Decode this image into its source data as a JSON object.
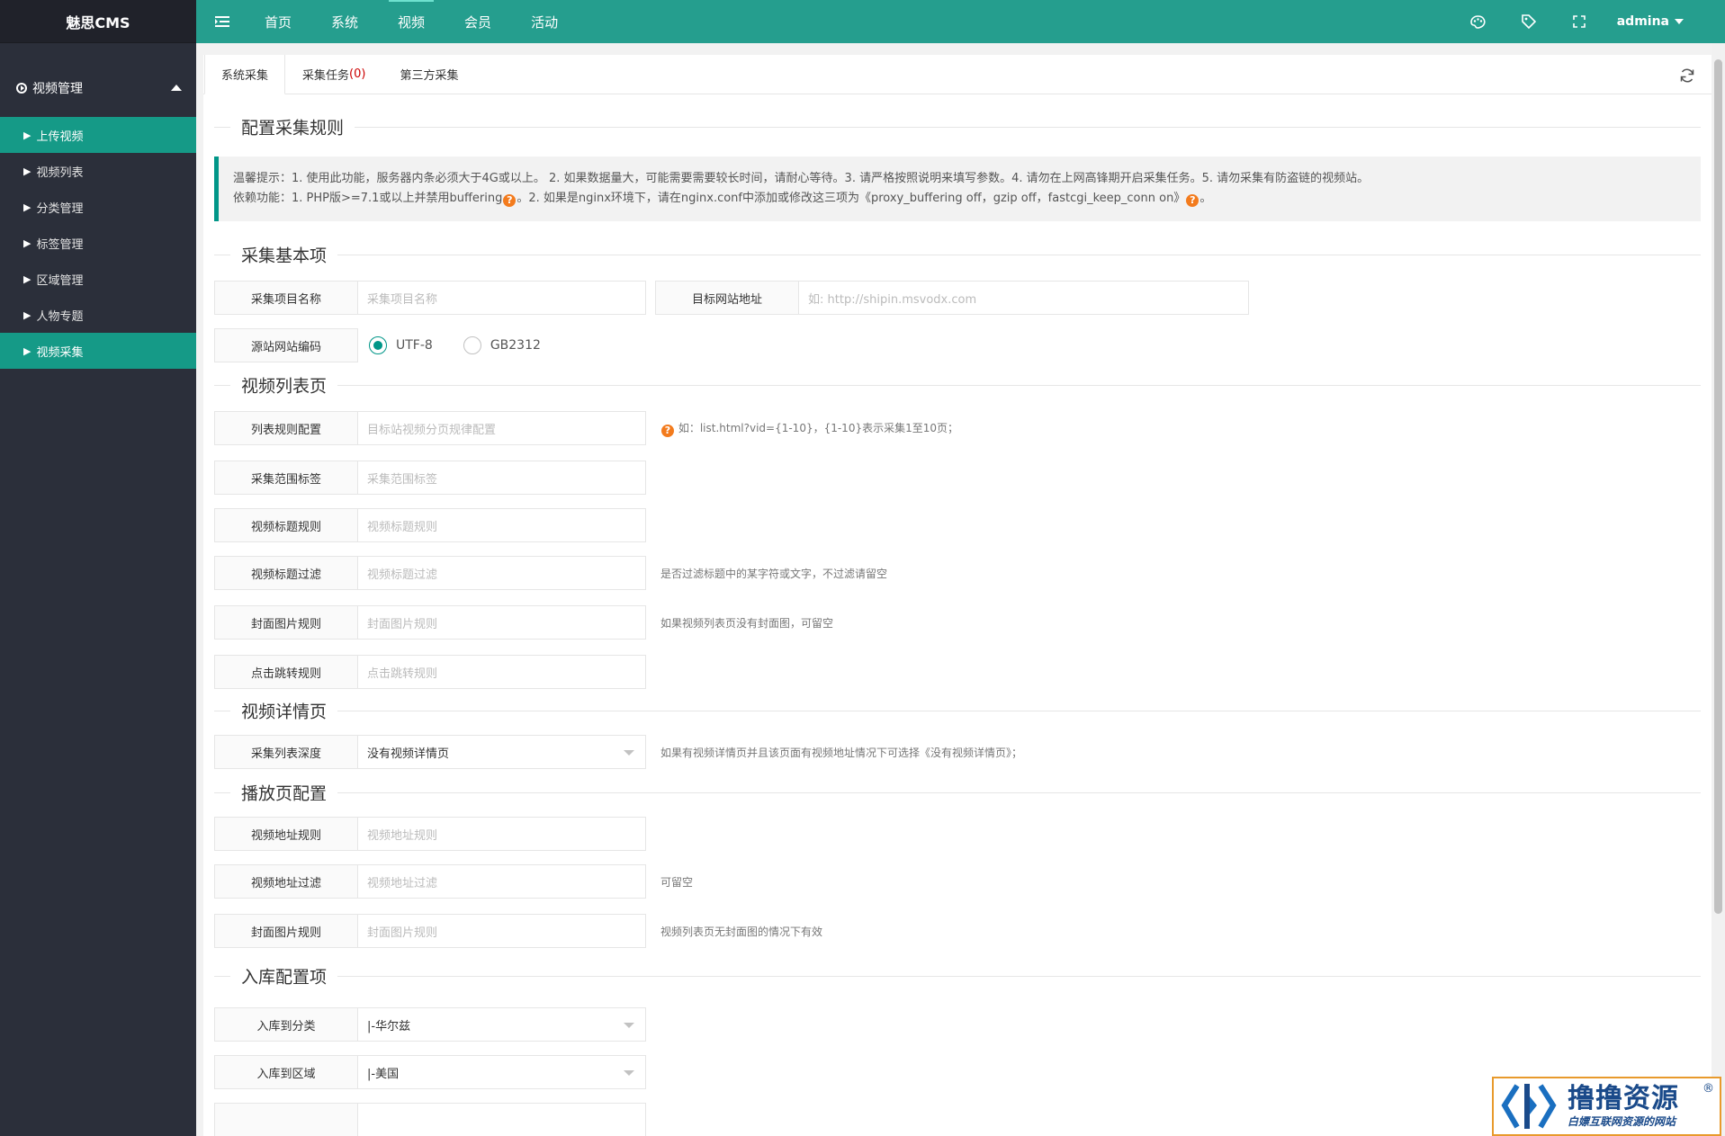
{
  "app": {
    "logo": "魅思CMS"
  },
  "sidebar": {
    "group_label": "视频管理",
    "items": [
      {
        "label": "上传视频",
        "active": true
      },
      {
        "label": "视频列表",
        "active": false
      },
      {
        "label": "分类管理",
        "active": false
      },
      {
        "label": "标签管理",
        "active": false
      },
      {
        "label": "区域管理",
        "active": false
      },
      {
        "label": "人物专题",
        "active": false
      },
      {
        "label": "视频采集",
        "active": true
      }
    ]
  },
  "topnav": {
    "items": [
      "首页",
      "系统",
      "视频",
      "会员",
      "活动"
    ],
    "active": "视频",
    "user": "admina"
  },
  "tabs": {
    "system": "系统采集",
    "task": "采集任务",
    "task_count": "(0)",
    "third": "第三方采集"
  },
  "sections": {
    "rules": "配置采集规则",
    "basic": "采集基本项",
    "list": "视频列表页",
    "detail": "视频详情页",
    "play": "播放页配置",
    "store": "入库配置项"
  },
  "tip": {
    "line1": "温馨提示：1. 使用此功能，服务器内条必须大于4G或以上。 2. 如果数据量大，可能需要需要较长时间，请耐心等待。3. 请严格按照说明来填写参数。4. 请勿在上网高锋期开启采集任务。5. 请勿采集有防盗链的视频站。",
    "line2a": "依赖功能：1. PHP版>=7.1或以上并禁用buffering",
    "line2b": "。2. 如果是nginx环境下，请在nginx.conf中添加或修改这三项为《proxy_buffering off，gzip off，fastcgi_keep_conn on》",
    "line2c": "。"
  },
  "basic": {
    "name_label": "采集项目名称",
    "name_placeholder": "采集项目名称",
    "url_label": "目标网站地址",
    "url_placeholder": "如: http://shipin.msvodx.com",
    "encoding_label": "源站网站编码",
    "enc_utf8": "UTF-8",
    "enc_gb": "GB2312"
  },
  "list": {
    "rule_label": "列表规则配置",
    "rule_placeholder": "目标站视频分页规律配置",
    "rule_hint": "如：list.html?vid={1-10}，{1-10}表示采集1至10页；",
    "range_label": "采集范围标签",
    "range_placeholder": "采集范围标签",
    "title_label": "视频标题规则",
    "title_placeholder": "视频标题规则",
    "filter_label": "视频标题过滤",
    "filter_placeholder": "视频标题过滤",
    "filter_hint": "是否过滤标题中的某字符或文字，不过滤请留空",
    "cover_label": "封面图片规则",
    "cover_placeholder": "封面图片规则",
    "cover_hint": "如果视频列表页没有封面图，可留空",
    "jump_label": "点击跳转规则",
    "jump_placeholder": "点击跳转规则"
  },
  "detail": {
    "depth_label": "采集列表深度",
    "depth_value": "没有视频详情页",
    "depth_hint": "如果有视频详情页并且该页面有视频地址情况下可选择《没有视频详情页》；"
  },
  "play": {
    "addr_label": "视频地址规则",
    "addr_placeholder": "视频地址规则",
    "addr_filter_label": "视频地址过滤",
    "addr_filter_placeholder": "视频地址过滤",
    "addr_filter_hint": "可留空",
    "cover_label": "封面图片规则",
    "cover_placeholder": "封面图片规则",
    "cover_hint": "视频列表页无封面图的情况下有效"
  },
  "store": {
    "category_label": "入库到分类",
    "category_value": "|-华尔兹",
    "region_label": "入库到区域",
    "region_value": "|-美国"
  },
  "watermark": {
    "main": "撸撸资源",
    "sub": "白嫖互联网资源的网站",
    "reg": "®"
  },
  "colors": {
    "accent": "#009688",
    "topbar": "#259e8e",
    "sidebar": "#2b2f3a"
  }
}
